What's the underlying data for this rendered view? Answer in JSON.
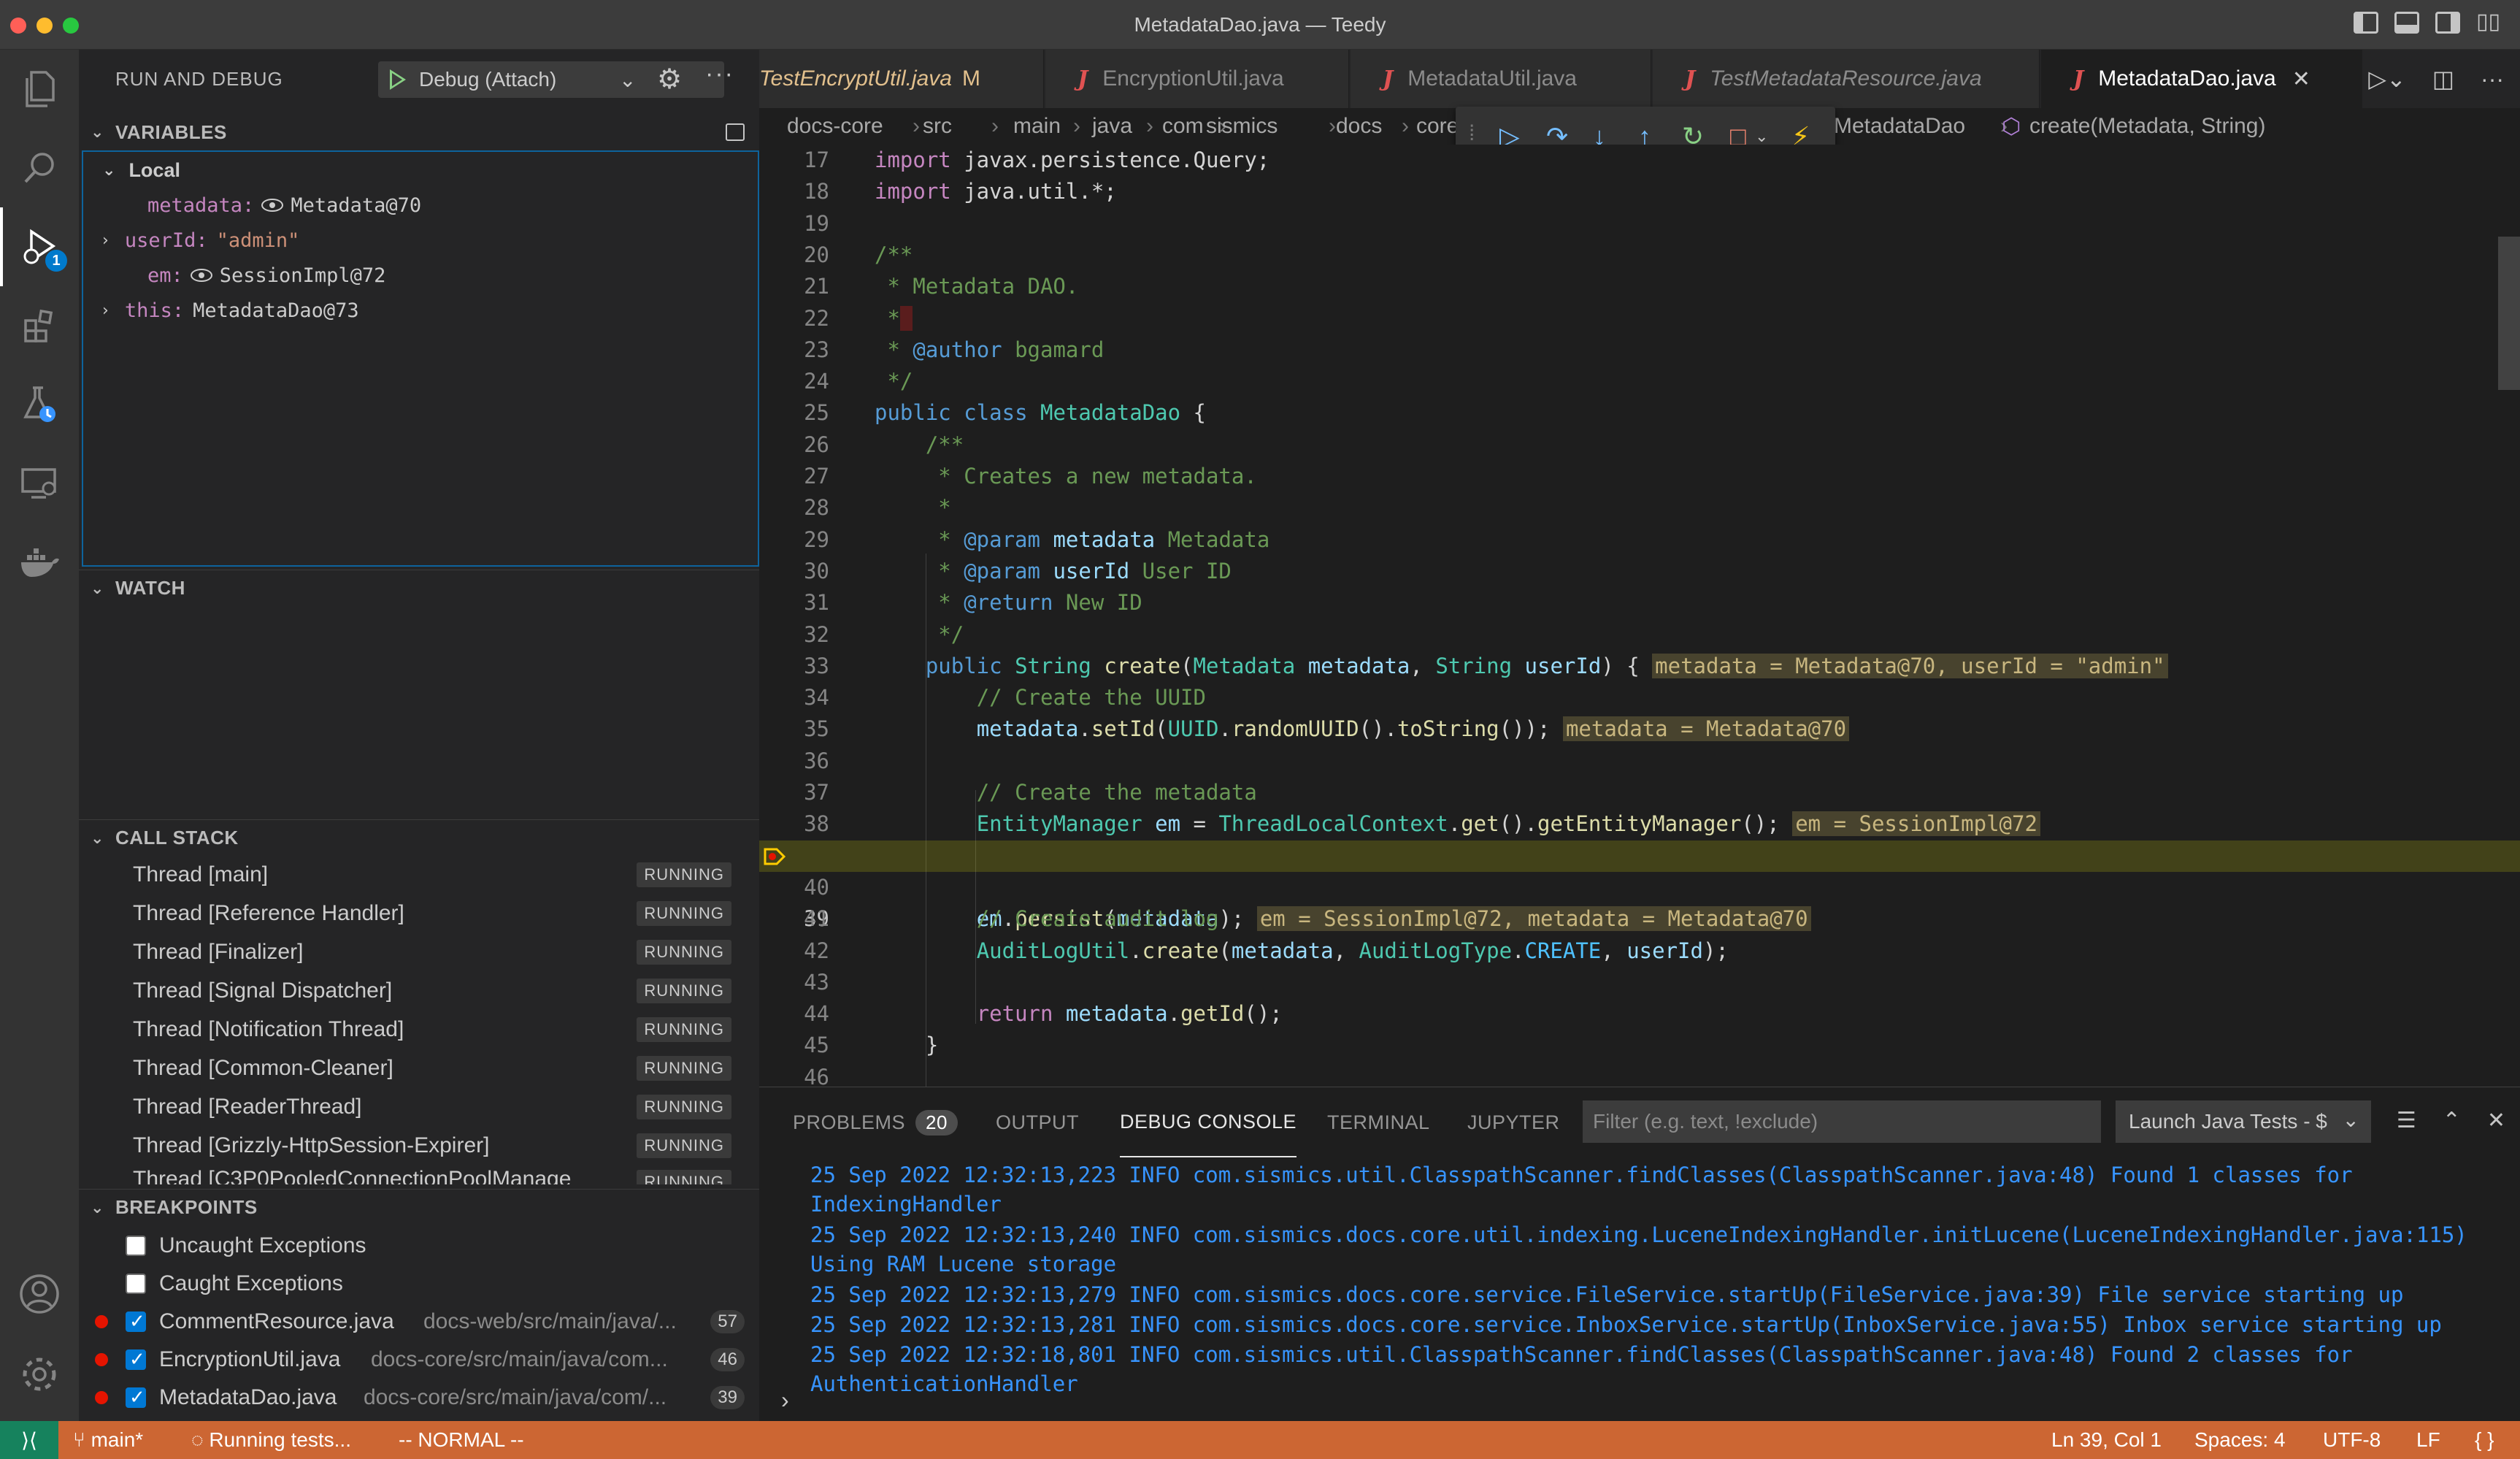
{
  "window": {
    "title": "MetadataDao.java — Teedy"
  },
  "activity_bar": {
    "items": [
      "files-icon",
      "search-icon",
      "run-debug-icon",
      "extensions-icon",
      "testing-icon",
      "remote-explorer-icon",
      "docker-icon",
      "account-icon",
      "manage-gear-icon"
    ],
    "debug_badge": "1"
  },
  "sidebar": {
    "title": "RUN AND DEBUG",
    "debug_config": "Debug (Attach)",
    "variables": {
      "title": "VARIABLES",
      "scope": "Local",
      "items": [
        {
          "name": "metadata:",
          "value": "Metadata@70"
        },
        {
          "name": "userId:",
          "value": "\"admin\""
        },
        {
          "name": "em:",
          "value": "SessionImpl@72"
        },
        {
          "name": "this:",
          "value": "MetadataDao@73"
        }
      ]
    },
    "watch": {
      "title": "WATCH"
    },
    "call_stack": {
      "title": "CALL STACK",
      "threads": [
        {
          "name": "Thread [main]",
          "status": "RUNNING"
        },
        {
          "name": "Thread [Reference Handler]",
          "status": "RUNNING"
        },
        {
          "name": "Thread [Finalizer]",
          "status": "RUNNING"
        },
        {
          "name": "Thread [Signal Dispatcher]",
          "status": "RUNNING"
        },
        {
          "name": "Thread [Notification Thread]",
          "status": "RUNNING"
        },
        {
          "name": "Thread [Common-Cleaner]",
          "status": "RUNNING"
        },
        {
          "name": "Thread [ReaderThread]",
          "status": "RUNNING"
        },
        {
          "name": "Thread [Grizzly-HttpSession-Expirer]",
          "status": "RUNNING"
        },
        {
          "name": "Thread [C3P0PooledConnectionPoolManage",
          "status": "RUNNING"
        }
      ]
    },
    "breakpoints": {
      "title": "BREAKPOINTS",
      "exceptions": [
        "Uncaught Exceptions",
        "Caught Exceptions"
      ],
      "items": [
        {
          "file": "CommentResource.java",
          "path": "docs-web/src/main/java/...",
          "line": "57"
        },
        {
          "file": "EncryptionUtil.java",
          "path": "docs-core/src/main/java/com...",
          "line": "46"
        },
        {
          "file": "MetadataDao.java",
          "path": "docs-core/src/main/java/com/...",
          "line": "39"
        }
      ]
    }
  },
  "editor": {
    "tabs": [
      {
        "label": "TestEncryptUtil.java",
        "modified": "M"
      },
      {
        "label": "EncryptionUtil.java"
      },
      {
        "label": "MetadataUtil.java"
      },
      {
        "label": "TestMetadataResource.java"
      },
      {
        "label": "MetadataDao.java"
      }
    ],
    "breadcrumb": [
      "docs-core",
      "src",
      "main",
      "java",
      "com",
      "sismics",
      "docs",
      "core",
      "MetadataDao",
      "create(Metadata, String)"
    ],
    "current_line": "39"
  },
  "panel": {
    "tabs": [
      {
        "label": "PROBLEMS",
        "count": "20"
      },
      {
        "label": "OUTPUT"
      },
      {
        "label": "DEBUG CONSOLE"
      },
      {
        "label": "TERMINAL"
      },
      {
        "label": "JUPYTER"
      }
    ],
    "filter_placeholder": "Filter (e.g. text, !exclude)",
    "launch_config": "Launch Java Tests - $",
    "console": [
      "25 Sep 2022 12:32:13,223 INFO com.sismics.util.ClasspathScanner.findClasses(ClasspathScanner.java:48) Found 1 classes for IndexingHandler",
      "25 Sep 2022 12:32:13,240 INFO com.sismics.docs.core.util.indexing.LuceneIndexingHandler.initLucene(LuceneIndexingHandler.java:115) Using RAM Lucene storage",
      "25 Sep 2022 12:32:13,279 INFO com.sismics.docs.core.service.FileService.startUp(FileService.java:39) File service starting up",
      "25 Sep 2022 12:32:13,281 INFO com.sismics.docs.core.service.InboxService.startUp(InboxService.java:55) Inbox service starting up",
      "25 Sep 2022 12:32:18,801 INFO com.sismics.util.ClasspathScanner.findClasses(ClasspathScanner.java:48) Found 2 classes for AuthenticationHandler"
    ]
  },
  "statusbar": {
    "branch": "main*",
    "tests": "Running tests...",
    "vim_mode": "-- NORMAL --",
    "position": "Ln 39, Col 1",
    "spaces": "Spaces: 4",
    "encoding": "UTF-8",
    "eol": "LF",
    "language": "{ }"
  },
  "colors": {
    "statusbar": "#cc6633",
    "remote": "#16825d",
    "accent": "#007acc"
  }
}
